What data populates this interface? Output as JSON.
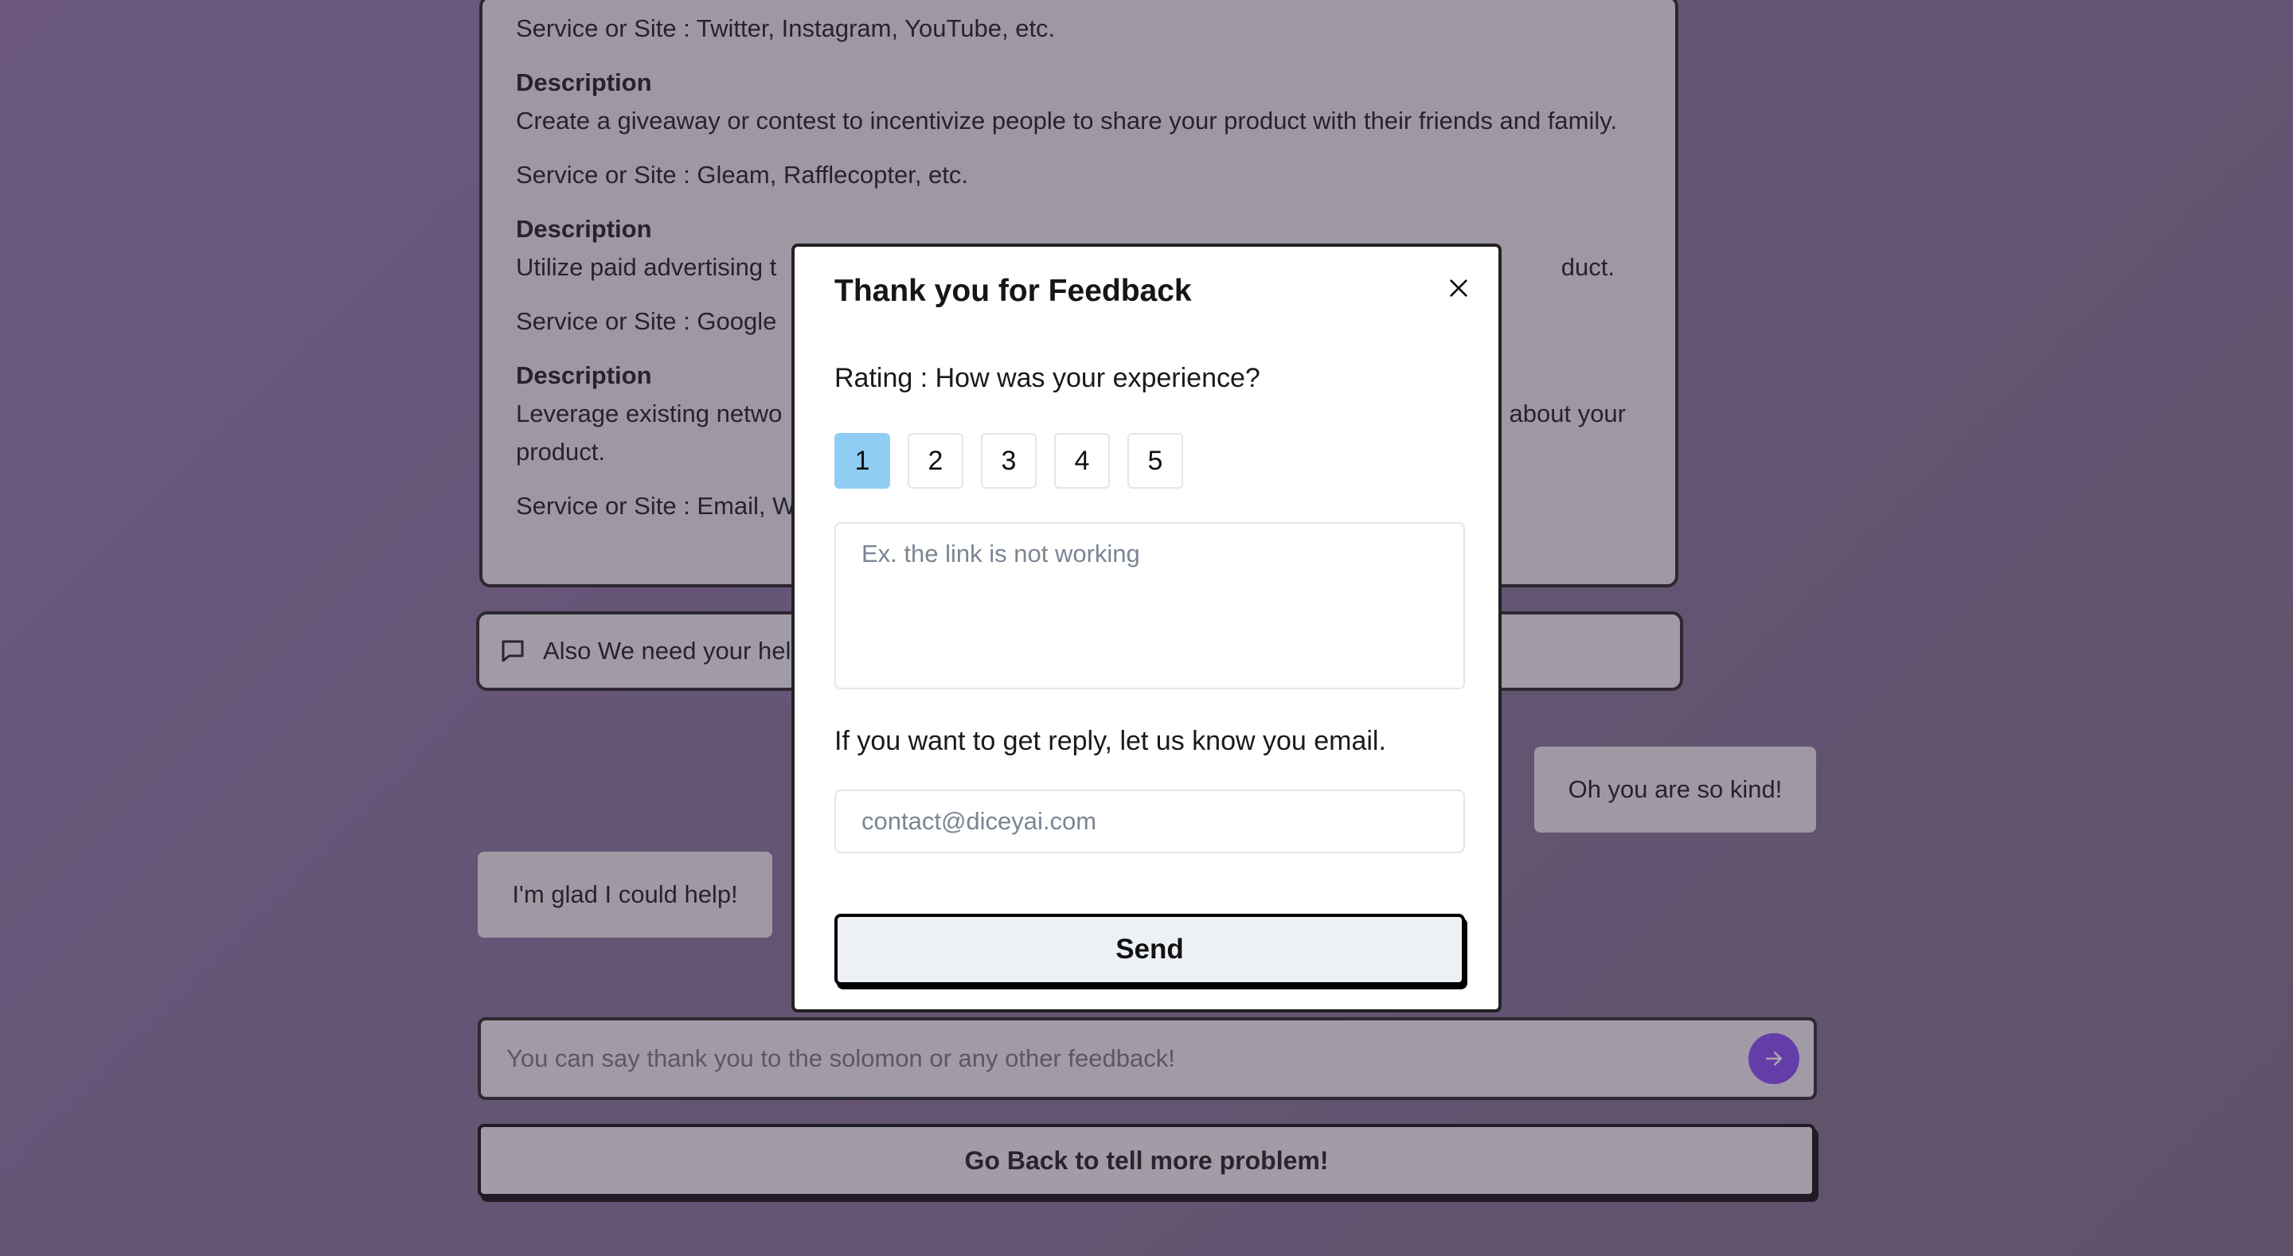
{
  "background": {
    "card": {
      "items": [
        {
          "type": "service",
          "text": "Service or Site : Twitter, Instagram, YouTube, etc."
        },
        {
          "type": "heading",
          "text": "Description"
        },
        {
          "type": "desc",
          "text": "Create a giveaway or contest to incentivize people to share your product with their friends and family."
        },
        {
          "type": "service",
          "text": "Service or Site : Gleam, Rafflecopter, etc."
        },
        {
          "type": "heading",
          "text": "Description"
        },
        {
          "type": "desc",
          "text": "Utilize paid advertising t"
        },
        {
          "type": "service",
          "text": "Service or Site : Google"
        },
        {
          "type": "heading",
          "text": "Description"
        },
        {
          "type": "desc",
          "text": "Leverage existing netwo"
        },
        {
          "type": "service",
          "text": "Service or Site : Email, W"
        }
      ],
      "fragments": {
        "desc_3_tail": "duct.",
        "desc_4_tail": "about your",
        "desc_4_line2": "product."
      }
    },
    "help_bar": {
      "icon": "message-square-icon",
      "text": "Also We need your hel"
    },
    "messages": {
      "user": "Oh you are so kind!",
      "bot": "I'm glad I could help!"
    },
    "chat_input": {
      "placeholder": "You can say thank you to the solomon or any other feedback!",
      "send_icon": "arrow-right-icon"
    },
    "go_back_label": "Go Back to tell more problem!"
  },
  "modal": {
    "title": "Thank you for Feedback",
    "close_icon": "close-icon",
    "rating_label": "Rating : How was your experience?",
    "ratings": [
      "1",
      "2",
      "3",
      "4",
      "5"
    ],
    "selected_rating": "1",
    "feedback_placeholder": "Ex. the link is not working",
    "email_label": "If you want to get reply, let us know you email.",
    "email_placeholder": "contact@diceyai.com",
    "send_label": "Send"
  },
  "colors": {
    "accent_purple": "#7e3ff2",
    "selected_rating": "#90cdf4"
  }
}
